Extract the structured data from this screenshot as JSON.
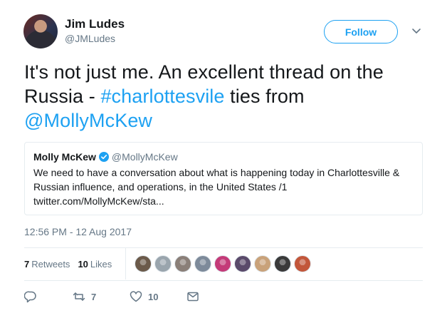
{
  "author": {
    "name": "Jim Ludes",
    "handle": "@JMLudes"
  },
  "follow_label": "Follow",
  "tweet": {
    "text_part1": "It's not just me.  An excellent thread on the Russia - ",
    "hashtag": "#charlottesvile",
    "text_part2": " ties from ",
    "mention": "@MollyMcKew"
  },
  "quote": {
    "name": "Molly McKew",
    "handle": "@MollyMcKew",
    "body": "We need to have a conversation about what is happening today in Charlottesville & Russian influence, and operations, in the United States /1",
    "link": "twitter.com/MollyMcKew/sta..."
  },
  "timestamp": "12:56 PM - 12 Aug 2017",
  "stats": {
    "retweets_count": "7",
    "retweets_label": "Retweets",
    "likes_count": "10",
    "likes_label": "Likes"
  },
  "likers": [
    "#6b5a4a",
    "#9aa5ad",
    "#8a7f78",
    "#7d8a9a",
    "#c43a78",
    "#5a4a6a",
    "#c9a27a",
    "#3a3a3a",
    "#c2563a"
  ],
  "actions": {
    "reply_count": "",
    "retweet_count": "7",
    "like_count": "10"
  },
  "colors": {
    "accent": "#1da1f2",
    "muted": "#657786",
    "text": "#14171a"
  }
}
